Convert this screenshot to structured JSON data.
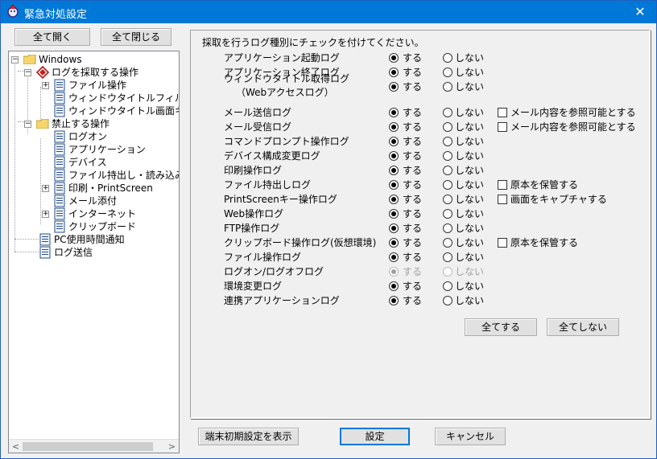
{
  "window": {
    "title": "緊急対処設定",
    "close_symbol": "✕"
  },
  "toolbar": {
    "expand_all": "全て開く",
    "collapse_all": "全て閉じる"
  },
  "tree": {
    "root": "Windows",
    "collect_group": "ログを採取する操作",
    "file_op": "ファイル操作",
    "window_title_filter": "ウィンドウタイトルフィルタ",
    "window_title_capture": "ウィンドウタイトル画面キャ",
    "prohibit_group": "禁止する操作",
    "logon": "ログオン",
    "application": "アプリケーション",
    "device": "デバイス",
    "file_export": "ファイル持出し・読み込み",
    "print": "印刷・PrintScreen",
    "mail_attach": "メール添付",
    "internet": "インターネット",
    "clipboard": "クリップボード",
    "pc_usage": "PC使用時間通知",
    "log_send": "ログ送信",
    "expander_plus": "+",
    "expander_minus": "−"
  },
  "instruction": "採取を行うログ種別にチェックを付けてください。",
  "radio": {
    "on": "する",
    "off": "しない"
  },
  "options": [
    {
      "label": "アプリケーション起動ログ",
      "value": "on"
    },
    {
      "label": "アプリケーション終了ログ",
      "value": "on"
    },
    {
      "label": "ウィンドウタイトル取得ログ",
      "label2": "（Webアクセスログ）",
      "value": "on"
    },
    {
      "label": "メール送信ログ",
      "value": "on",
      "extra": "メール内容を参照可能とする"
    },
    {
      "label": "メール受信ログ",
      "value": "on",
      "extra": "メール内容を参照可能とする"
    },
    {
      "label": "コマンドプロンプト操作ログ",
      "value": "on"
    },
    {
      "label": "デバイス構成変更ログ",
      "value": "on"
    },
    {
      "label": "印刷操作ログ",
      "value": "on"
    },
    {
      "label": "ファイル持出しログ",
      "value": "on",
      "extra": "原本を保管する"
    },
    {
      "label": "PrintScreenキー操作ログ",
      "value": "on",
      "extra": "画面をキャプチャする"
    },
    {
      "label": "Web操作ログ",
      "value": "on"
    },
    {
      "label": "FTP操作ログ",
      "value": "on"
    },
    {
      "label": "クリップボード操作ログ(仮想環境)",
      "value": "on",
      "extra": "原本を保管する"
    },
    {
      "label": "ファイル操作ログ",
      "value": "on"
    },
    {
      "label": "ログオン/ログオフログ",
      "value": "on",
      "disabled": true
    },
    {
      "label": "環境変更ログ",
      "value": "on"
    },
    {
      "label": "連携アプリケーションログ",
      "value": "on"
    }
  ],
  "panel_buttons": {
    "all_on": "全てする",
    "all_off": "全てしない"
  },
  "footer": {
    "show_initial": "端末初期設定を表示",
    "apply": "設定",
    "cancel": "キャンセル"
  },
  "scroll": {
    "left": "<",
    "right": ">"
  },
  "colors": {
    "titlebar": "#0078d7",
    "folder": "#f5d56b",
    "default_border": "#0078d7"
  }
}
